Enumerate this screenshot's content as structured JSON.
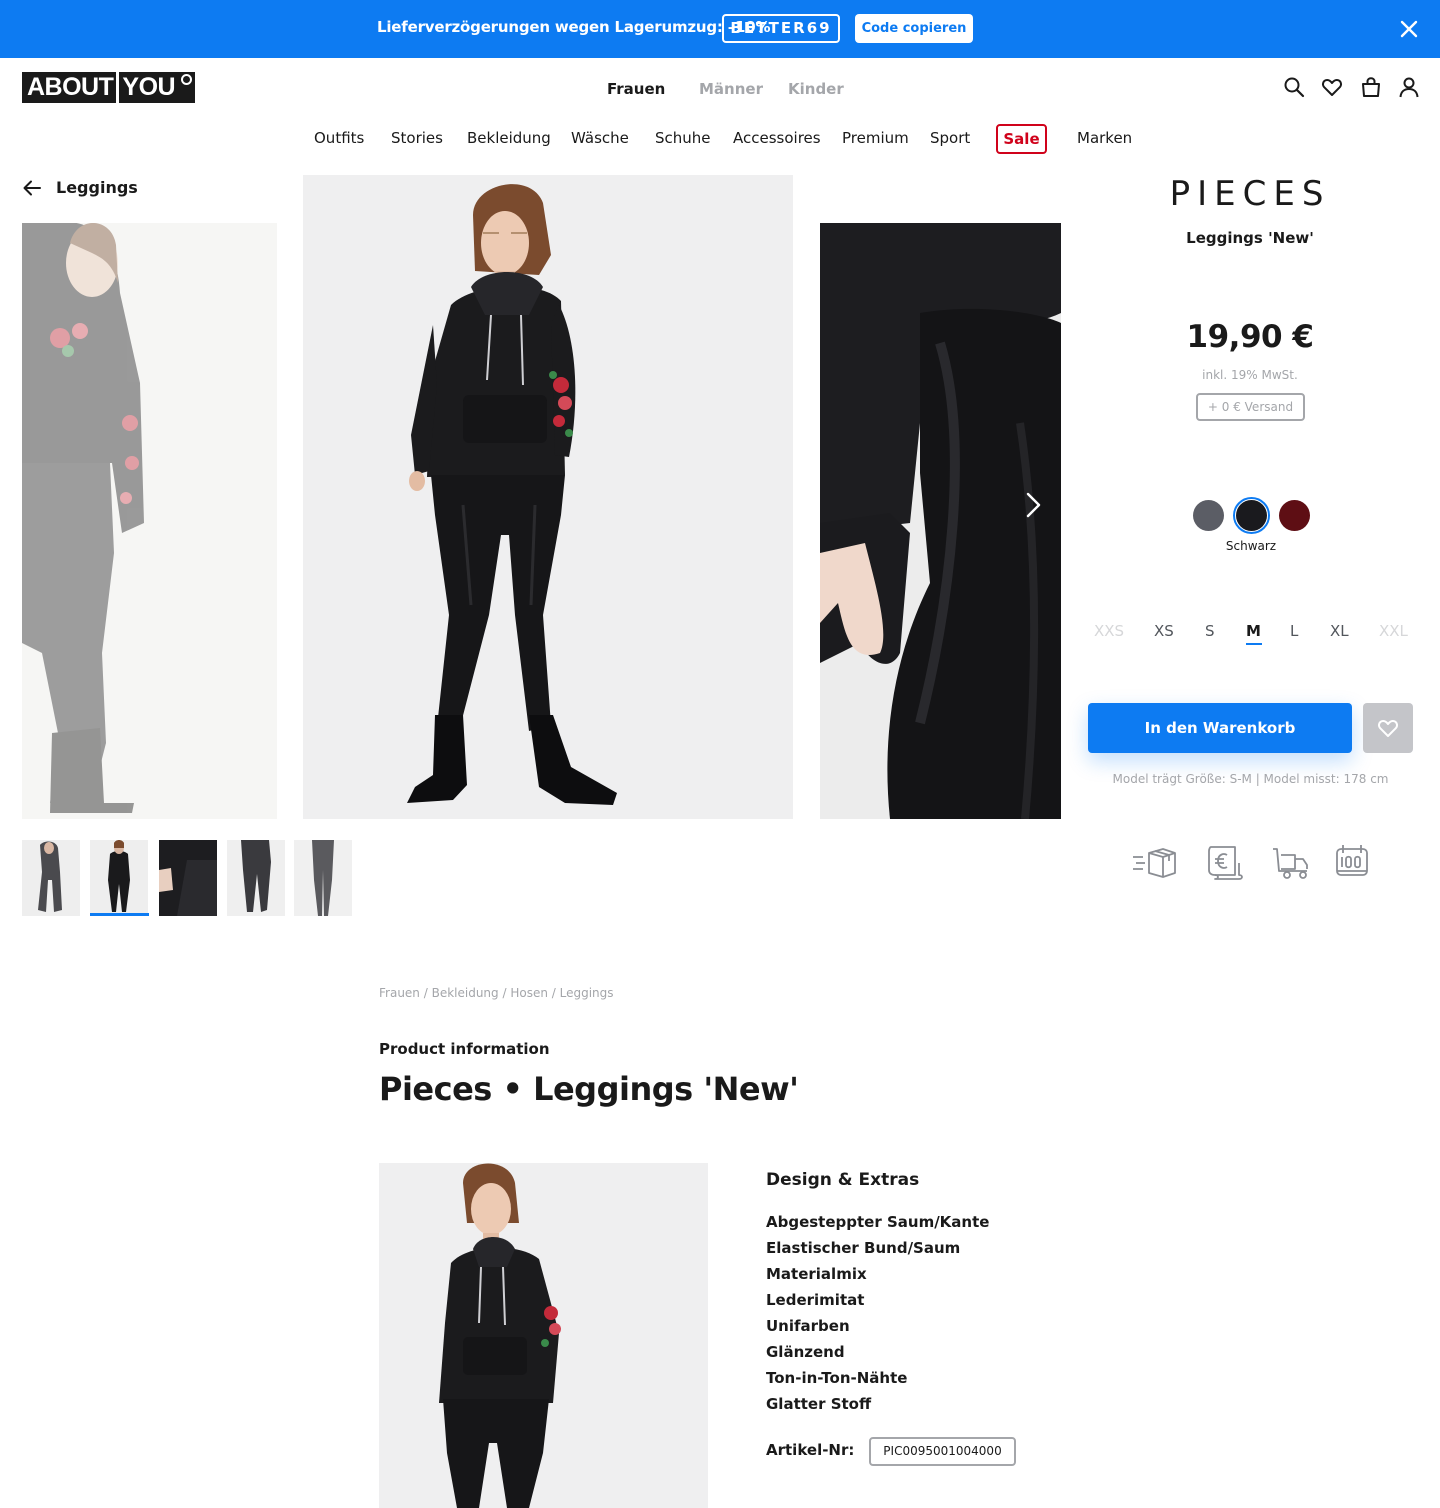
{
  "promo": {
    "text": "Lieferverzögerungen wegen Lagerumzug: –10%",
    "code": "BETTER69",
    "copy_label": "Code copieren"
  },
  "header": {
    "logo": {
      "part1": "ABOUT",
      "part2": "YOU"
    },
    "genders": [
      "Frauen",
      "Männer",
      "Kinder"
    ],
    "active_gender": "Frauen",
    "icons": [
      "search-icon",
      "heart-icon",
      "bag-icon",
      "user-icon"
    ]
  },
  "nav": {
    "items": [
      "Outfits",
      "Stories",
      "Bekleidung",
      "Wäsche",
      "Schuhe",
      "Accessoires",
      "Premium",
      "Sport",
      "Sale",
      "Marken"
    ],
    "sale_color": "#d0021b"
  },
  "back": {
    "label": "Leggings"
  },
  "product": {
    "brand": "PIECES",
    "name": "Leggings 'New'",
    "price": "19,90 €",
    "vat": "inkl. 19% MwSt.",
    "shipping": "+ 0 € Versand",
    "colors": [
      {
        "name": "Grau",
        "hex": "#5b5d65"
      },
      {
        "name": "Schwarz",
        "hex": "#1a1a1e"
      },
      {
        "name": "Rot",
        "hex": "#5e0e14"
      }
    ],
    "selected_color": "Schwarz",
    "sizes": [
      {
        "label": "XXS",
        "available": false
      },
      {
        "label": "XS",
        "available": true
      },
      {
        "label": "S",
        "available": true
      },
      {
        "label": "M",
        "available": true
      },
      {
        "label": "L",
        "available": true
      },
      {
        "label": "XL",
        "available": true
      },
      {
        "label": "XXL",
        "available": false
      }
    ],
    "selected_size": "M",
    "cart_label": "In den Warenkorb",
    "model_info": "Model trägt Größe: S-M | Model misst: 178 cm",
    "usp_icons": [
      "fast-delivery-icon",
      "invoice-icon",
      "free-shipping-icon",
      "return-100-icon"
    ],
    "accent_color": "#0d7bf2"
  },
  "details": {
    "breadcrumb": [
      "Frauen",
      "Bekleidung",
      "Hosen",
      "Leggings"
    ],
    "section_label": "Product information",
    "title": "Pieces • Leggings 'New'",
    "design_heading": "Design & Extras",
    "features": [
      "Abgesteppter Saum/Kante",
      "Elastischer Bund/Saum",
      "Materialmix",
      "Lederimitat",
      "Unifarben",
      "Glänzend",
      "Ton-in-Ton-Nähte",
      "Glatter Stoff"
    ],
    "article_label": "Artikel-Nr:",
    "article_number": "PIC0095001004000"
  }
}
